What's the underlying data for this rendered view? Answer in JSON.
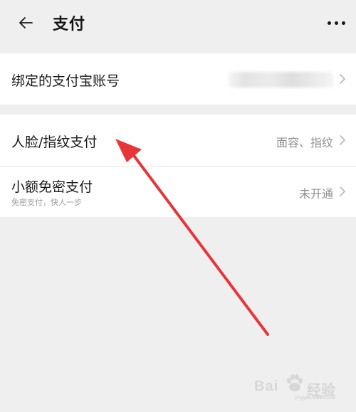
{
  "header": {
    "title": "支付",
    "back_icon": "arrow-left-icon",
    "more_icon": "more-horizontal-icon"
  },
  "account_section": {
    "items": [
      {
        "label": "绑定的支付宝账号",
        "value_blurred": true,
        "chevron_icon": "chevron-right-icon"
      }
    ]
  },
  "settings_section": {
    "items": [
      {
        "label": "人脸/指纹支付",
        "value": "面容、指纹",
        "chevron_icon": "chevron-right-icon"
      },
      {
        "label": "小额免密支付",
        "sublabel": "免密支付，快人一步",
        "value": "未开通",
        "chevron_icon": "chevron-right-icon"
      }
    ]
  },
  "annotation": {
    "icon": "red-arrow-icon",
    "color": "#e8353a",
    "points_to": "人脸/指纹支付"
  },
  "watermark": {
    "text_left": "Bai",
    "text_right": "经验",
    "url": "jingyan.baidu.com",
    "icon": "baidu-paw-icon"
  },
  "colors": {
    "background": "#efefef",
    "card": "#ffffff",
    "primary_text": "#1a1a1a",
    "secondary_text": "#8f8f8f"
  }
}
